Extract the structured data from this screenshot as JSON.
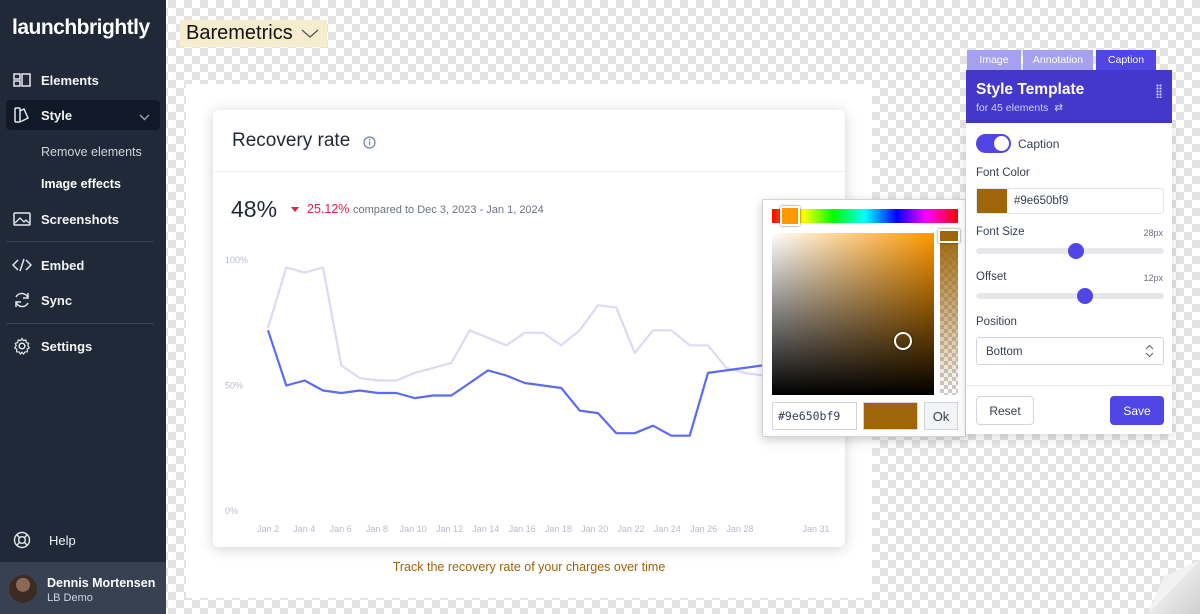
{
  "brand": {
    "logo_text": "launchbrightly"
  },
  "sidebar": {
    "items": [
      {
        "label": "Elements",
        "icon": "layout-icon"
      },
      {
        "label": "Style",
        "icon": "palette-icon"
      },
      {
        "label": "Screenshots",
        "icon": "image-icon"
      },
      {
        "label": "Embed",
        "icon": "code-icon"
      },
      {
        "label": "Sync",
        "icon": "refresh-icon"
      },
      {
        "label": "Settings",
        "icon": "gear-icon"
      }
    ],
    "style_sub": [
      "Remove elements",
      "Image effects"
    ],
    "help": "Help",
    "user": {
      "name": "Dennis Mortensen",
      "org": "LB Demo"
    }
  },
  "doc_title": "Baremetrics",
  "card": {
    "title": "Recovery rate",
    "value": "48%",
    "delta": "25.12%",
    "compare": "compared to Dec 3, 2023 - Jan 1, 2024"
  },
  "caption_text": "Track the recovery rate of your charges over time",
  "chart_data": {
    "type": "line",
    "x": [
      "Jan 2",
      "Jan 3",
      "Jan 4",
      "Jan 5",
      "Jan 6",
      "Jan 7",
      "Jan 8",
      "Jan 9",
      "Jan 10",
      "Jan 11",
      "Jan 12",
      "Jan 13",
      "Jan 14",
      "Jan 15",
      "Jan 16",
      "Jan 17",
      "Jan 18",
      "Jan 19",
      "Jan 20",
      "Jan 21",
      "Jan 22",
      "Jan 23",
      "Jan 24",
      "Jan 25",
      "Jan 26",
      "Jan 27",
      "Jan 28",
      "Jan 29"
    ],
    "xticks": [
      "Jan 2",
      "Jan 4",
      "Jan 6",
      "Jan 8",
      "Jan 10",
      "Jan 12",
      "Jan 14",
      "Jan 16",
      "Jan 18",
      "Jan 20",
      "Jan 22",
      "Jan 24",
      "Jan 26",
      "Jan 28",
      "Jan 31"
    ],
    "yticks": [
      "100%",
      "50%",
      "0%"
    ],
    "ylim": [
      0,
      100
    ],
    "series": [
      {
        "values": [
          73,
          97,
          95,
          97,
          58,
          53,
          52,
          52,
          55,
          57,
          59,
          72,
          69,
          66,
          71,
          71,
          66,
          72,
          82,
          81,
          63,
          72,
          72,
          66,
          66,
          57,
          55,
          54
        ],
        "color": "#dcdaf5"
      },
      {
        "values": [
          72,
          50,
          52,
          48,
          47,
          48,
          47,
          47,
          45,
          46,
          46,
          51,
          56,
          54,
          51,
          50,
          49,
          40,
          39,
          31,
          31,
          34,
          30,
          30,
          55,
          56,
          57,
          58
        ],
        "color": "#5b6cf0"
      }
    ]
  },
  "picker": {
    "hex": "#9e650bf9",
    "ok": "Ok"
  },
  "panel": {
    "tabs": [
      "Image",
      "Annotation",
      "Caption"
    ],
    "title": "Style Template",
    "subtitle": "for 45 elements",
    "toggle_label": "Caption",
    "font_color_label": "Font Color",
    "font_color_hex": "#9e650bf9",
    "font_size_label": "Font Size",
    "font_size_value": "28px",
    "font_size_level": 0.53,
    "offset_label": "Offset",
    "offset_value": "12px",
    "offset_level": 0.58,
    "position_label": "Position",
    "position_value": "Bottom",
    "reset": "Reset",
    "save": "Save"
  }
}
